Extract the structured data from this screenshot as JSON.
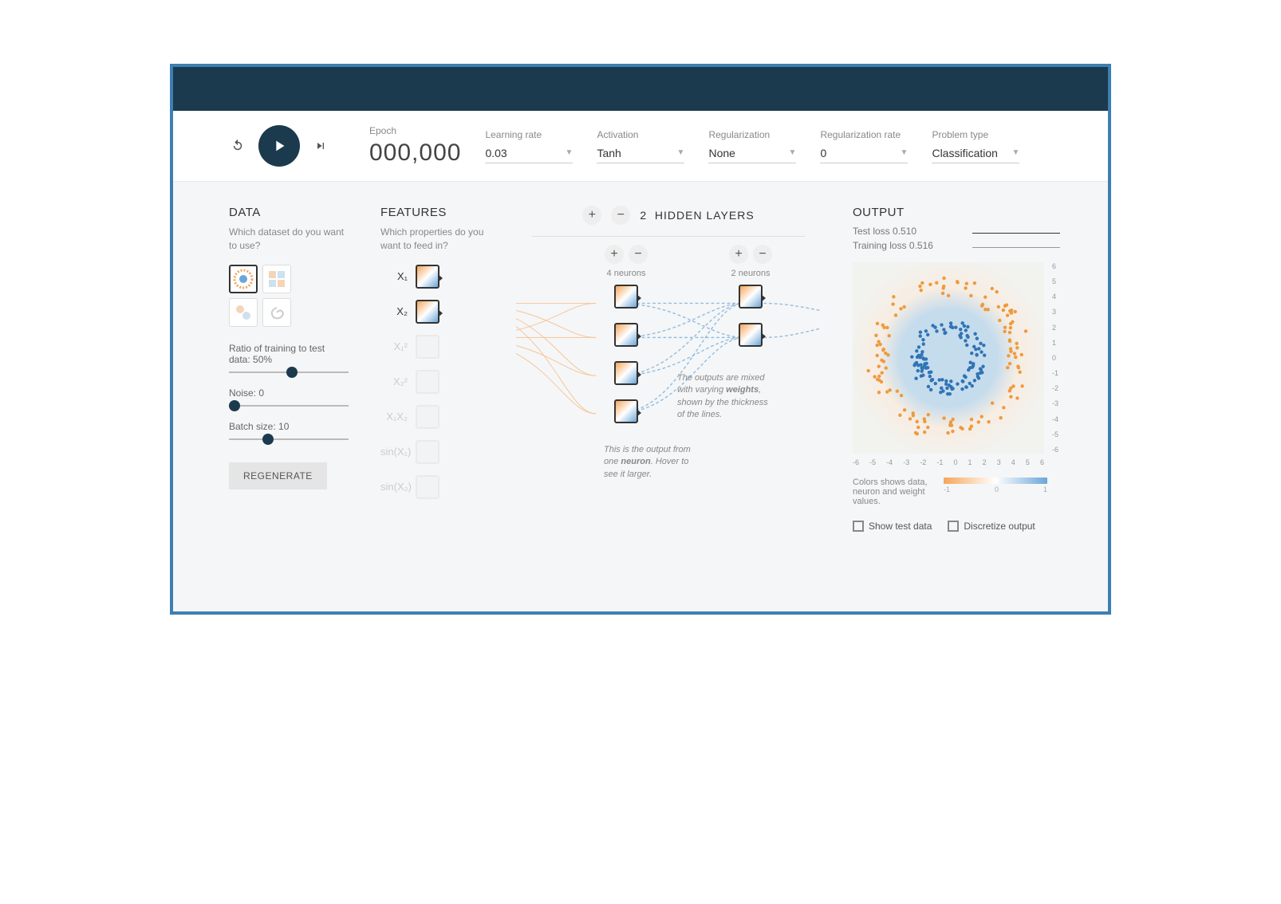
{
  "controls": {
    "epoch_label": "Epoch",
    "epoch_value": "000,000",
    "learning_rate": {
      "label": "Learning rate",
      "value": "0.03"
    },
    "activation": {
      "label": "Activation",
      "value": "Tanh"
    },
    "regularization": {
      "label": "Regularization",
      "value": "None"
    },
    "regularization_rate": {
      "label": "Regularization rate",
      "value": "0"
    },
    "problem_type": {
      "label": "Problem type",
      "value": "Classification"
    }
  },
  "data": {
    "title": "DATA",
    "subtitle": "Which dataset do you want to use?",
    "ratio_label": "Ratio of training to test data:  50%",
    "noise_label": "Noise:  0",
    "batch_label": "Batch size:  10",
    "regenerate": "REGENERATE"
  },
  "features": {
    "title": "FEATURES",
    "subtitle": "Which properties do you want to feed in?",
    "items": [
      {
        "label": "X₁",
        "active": true
      },
      {
        "label": "X₂",
        "active": true
      },
      {
        "label": "X₁²",
        "active": false
      },
      {
        "label": "X₂²",
        "active": false
      },
      {
        "label": "X₁X₂",
        "active": false
      },
      {
        "label": "sin(X₁)",
        "active": false
      },
      {
        "label": "sin(X₂)",
        "active": false
      }
    ]
  },
  "network": {
    "hidden_layers_count": "2",
    "hidden_layers_label": "HIDDEN LAYERS",
    "layers": [
      {
        "neurons": 4,
        "label": "4 neurons"
      },
      {
        "neurons": 2,
        "label": "2 neurons"
      }
    ],
    "callout_neuron": "This is the output from one neuron. Hover to see it larger.",
    "callout_weights": "The outputs are mixed with varying weights, shown by the thickness of the lines."
  },
  "output": {
    "title": "OUTPUT",
    "test_loss": "Test loss 0.510",
    "training_loss": "Training loss 0.516",
    "axis_ticks": [
      "-6",
      "-5",
      "-4",
      "-3",
      "-2",
      "-1",
      "0",
      "1",
      "2",
      "3",
      "4",
      "5",
      "6"
    ],
    "legend_text": "Colors shows data, neuron and weight values.",
    "legend_min": "-1",
    "legend_mid": "0",
    "legend_max": "1",
    "show_test": "Show test data",
    "discretize": "Discretize output"
  }
}
